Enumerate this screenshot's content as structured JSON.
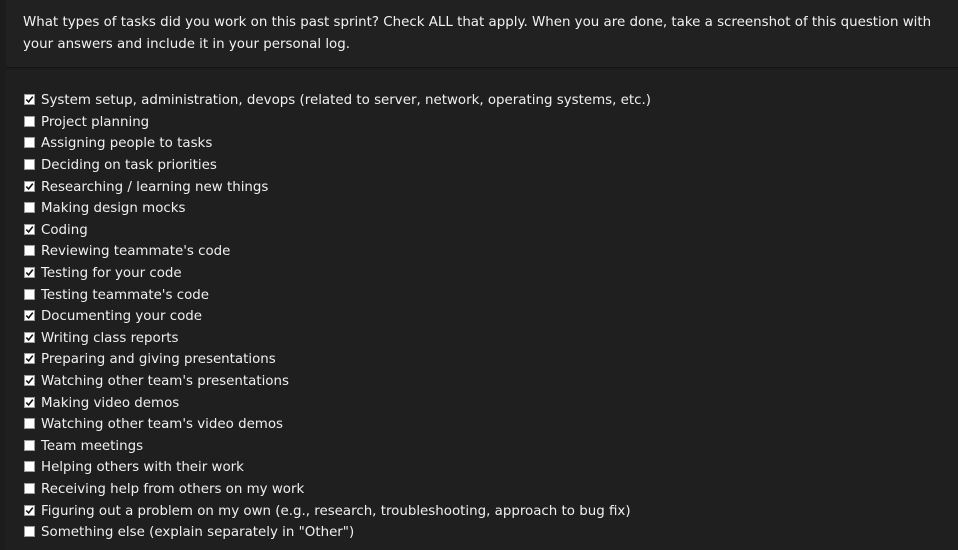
{
  "question": {
    "text": "What types of tasks did you work on this past sprint? Check ALL that apply. When you are done, take a screenshot of this question with your answers and include it in your personal log."
  },
  "answers": [
    {
      "label": "System setup, administration, devops (related to server, network, operating systems, etc.)",
      "checked": true
    },
    {
      "label": "Project planning",
      "checked": false
    },
    {
      "label": "Assigning people to tasks",
      "checked": false
    },
    {
      "label": "Deciding on task priorities",
      "checked": false
    },
    {
      "label": "Researching / learning new things",
      "checked": true
    },
    {
      "label": "Making design mocks",
      "checked": false
    },
    {
      "label": "Coding",
      "checked": true
    },
    {
      "label": "Reviewing teammate's code",
      "checked": false
    },
    {
      "label": "Testing for your code",
      "checked": true
    },
    {
      "label": "Testing teammate's code",
      "checked": false
    },
    {
      "label": "Documenting your code",
      "checked": true
    },
    {
      "label": "Writing class reports",
      "checked": true
    },
    {
      "label": "Preparing and giving presentations",
      "checked": true
    },
    {
      "label": "Watching other team's presentations",
      "checked": true
    },
    {
      "label": "Making video demos",
      "checked": true
    },
    {
      "label": "Watching other team's video demos",
      "checked": false
    },
    {
      "label": "Team meetings",
      "checked": false
    },
    {
      "label": "Helping others with their work",
      "checked": false
    },
    {
      "label": "Receiving help from others on my work",
      "checked": false
    },
    {
      "label": "Figuring out a problem on my own (e.g., research, troubleshooting, approach to bug fix)",
      "checked": true
    },
    {
      "label": "Something else (explain separately in \"Other\")",
      "checked": false
    }
  ],
  "colors": {
    "background": "#1c1c1c",
    "panel": "#212121",
    "text": "#f0f0f0",
    "checkbox_fill": "#ffffff",
    "check_mark": "#111111"
  }
}
